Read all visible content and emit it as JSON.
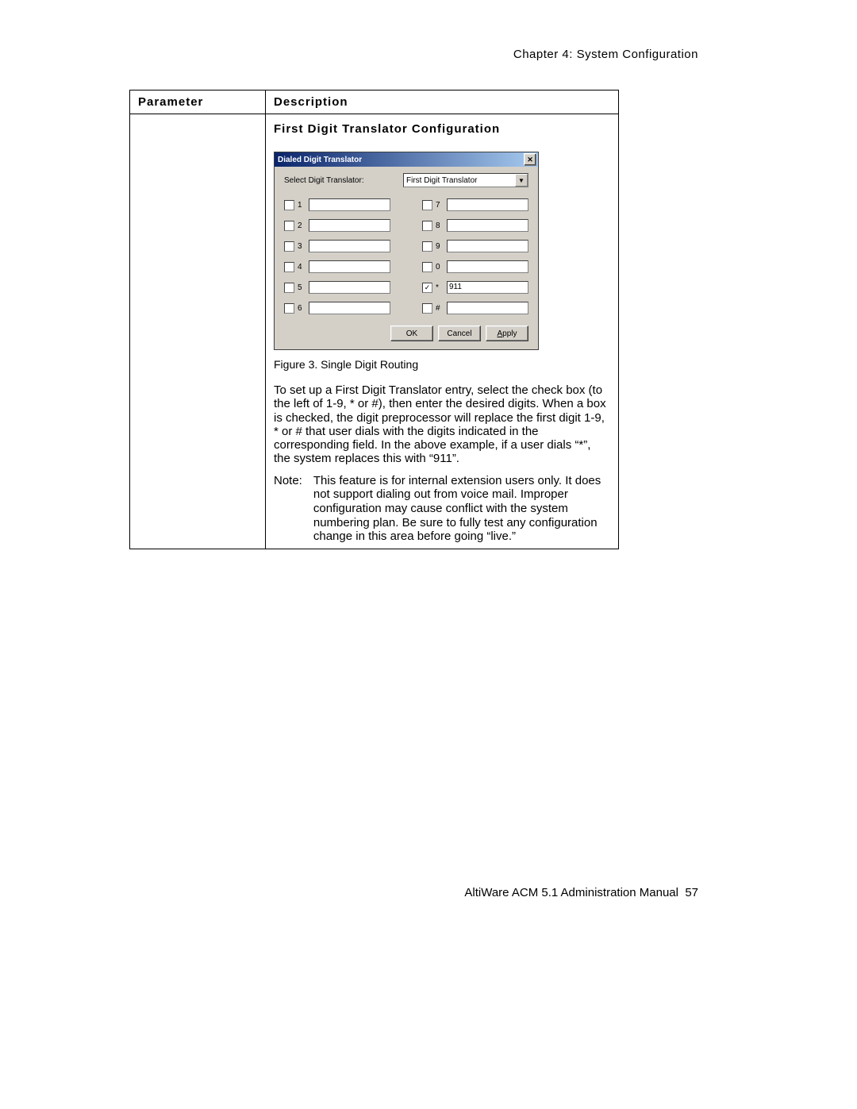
{
  "header": "Chapter 4:  System Configuration",
  "table": {
    "col1": "Parameter",
    "col2": "Description",
    "section_title": "First Digit Translator Configuration"
  },
  "dialog": {
    "title": "Dialed Digit Translator",
    "close": "✕",
    "select_label": "Select Digit Translator:",
    "select_value": "First Digit Translator",
    "rows": [
      {
        "label": "1",
        "checked": false,
        "value": "",
        "label2": "7",
        "checked2": false,
        "value2": ""
      },
      {
        "label": "2",
        "checked": false,
        "value": "",
        "label2": "8",
        "checked2": false,
        "value2": ""
      },
      {
        "label": "3",
        "checked": false,
        "value": "",
        "label2": "9",
        "checked2": false,
        "value2": ""
      },
      {
        "label": "4",
        "checked": false,
        "value": "",
        "label2": "0",
        "checked2": false,
        "value2": ""
      },
      {
        "label": "5",
        "checked": false,
        "value": "",
        "label2": "*",
        "checked2": true,
        "value2": "911"
      },
      {
        "label": "6",
        "checked": false,
        "value": "",
        "label2": "#",
        "checked2": false,
        "value2": ""
      }
    ],
    "buttons": {
      "ok": "OK",
      "cancel": "Cancel",
      "apply": "Apply"
    }
  },
  "figure_caption_prefix": "Figure 3.   ",
  "figure_caption": "Single Digit Routing",
  "paragraph": "To set up a First Digit Translator entry, select the check box (to the left of 1-9, * or #), then enter the desired digits. When a box is checked, the digit preprocessor will replace the first digit 1-9, * or # that user dials with the digits indicated in the corresponding field. In the above example, if a user dials “*”, the system replaces this with “911”.",
  "note_label": "Note:",
  "note_body": "This feature is for internal extension users only. It does not support dialing out from voice mail. Improper configuration may cause conflict with the system numbering plan. Be sure to fully test any configuration change in this area before going “live.”",
  "footer_title": "AltiWare ACM 5.1 Administration Manual",
  "footer_page": "57"
}
